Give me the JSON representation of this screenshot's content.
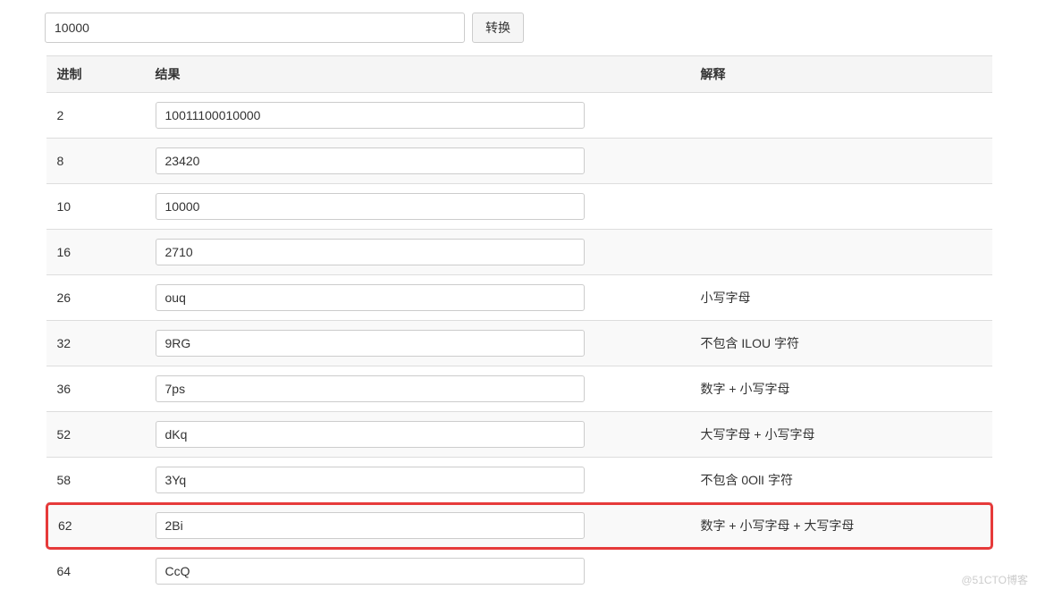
{
  "input": {
    "value": "10000"
  },
  "button": {
    "convert_label": "转换"
  },
  "table": {
    "headers": {
      "base": "进制",
      "result": "结果",
      "desc": "解释"
    },
    "rows": [
      {
        "base": "2",
        "result": "10011100010000",
        "desc": "",
        "highlight": false
      },
      {
        "base": "8",
        "result": "23420",
        "desc": "",
        "highlight": false
      },
      {
        "base": "10",
        "result": "10000",
        "desc": "",
        "highlight": false
      },
      {
        "base": "16",
        "result": "2710",
        "desc": "",
        "highlight": false
      },
      {
        "base": "26",
        "result": "ouq",
        "desc": "小写字母",
        "highlight": false
      },
      {
        "base": "32",
        "result": "9RG",
        "desc": "不包含 ILOU 字符",
        "highlight": false
      },
      {
        "base": "36",
        "result": "7ps",
        "desc": "数字 + 小写字母",
        "highlight": false
      },
      {
        "base": "52",
        "result": "dKq",
        "desc": "大写字母 + 小写字母",
        "highlight": false
      },
      {
        "base": "58",
        "result": "3Yq",
        "desc": "不包含 0OlI 字符",
        "highlight": false
      },
      {
        "base": "62",
        "result": "2Bi",
        "desc": "数字 + 小写字母 + 大写字母",
        "highlight": true
      },
      {
        "base": "64",
        "result": "CcQ",
        "desc": "",
        "highlight": false
      }
    ]
  },
  "watermark": "@51CTO博客"
}
